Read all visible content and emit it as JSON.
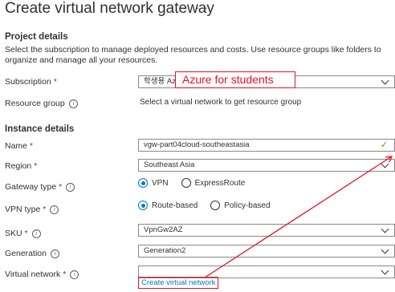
{
  "page": {
    "title": "Create virtual network gateway",
    "more": "···"
  },
  "project": {
    "heading": "Project details",
    "description": "Select the subscription to manage deployed resources and costs. Use resource groups like folders to organize and manage all your resources.",
    "subscription": {
      "label": "Subscription",
      "required": "*",
      "value": "학생용 Azure",
      "annotation": "Azure for students"
    },
    "resource_group": {
      "label": "Resource group",
      "info": "i",
      "text": "Select a virtual network to get resource group"
    }
  },
  "instance": {
    "heading": "Instance details",
    "name": {
      "label": "Name",
      "required": "*",
      "value": "vgw-part04cloud-southeastasia",
      "check": "✓"
    },
    "region": {
      "label": "Region",
      "required": "*",
      "value": "Southeast Asia"
    },
    "gateway_type": {
      "label": "Gateway type",
      "required": "*",
      "info": "i",
      "options": [
        "VPN",
        "ExpressRoute"
      ],
      "selected": "VPN"
    },
    "vpn_type": {
      "label": "VPN type",
      "required": "*",
      "info": "i",
      "options": [
        "Route-based",
        "Policy-based"
      ],
      "selected": "Route-based"
    },
    "sku": {
      "label": "SKU",
      "required": "*",
      "info": "i",
      "value": "VpnGw2AZ"
    },
    "generation": {
      "label": "Generation",
      "info": "i",
      "value": "Generation2"
    },
    "virtual_network": {
      "label": "Virtual network",
      "required": "*",
      "info": "i",
      "value": "",
      "link": "Create virtual network"
    }
  },
  "colors": {
    "accent": "#0078d4",
    "annotation": "#e81123",
    "required": "#a4262c",
    "valid": "#57a300"
  }
}
